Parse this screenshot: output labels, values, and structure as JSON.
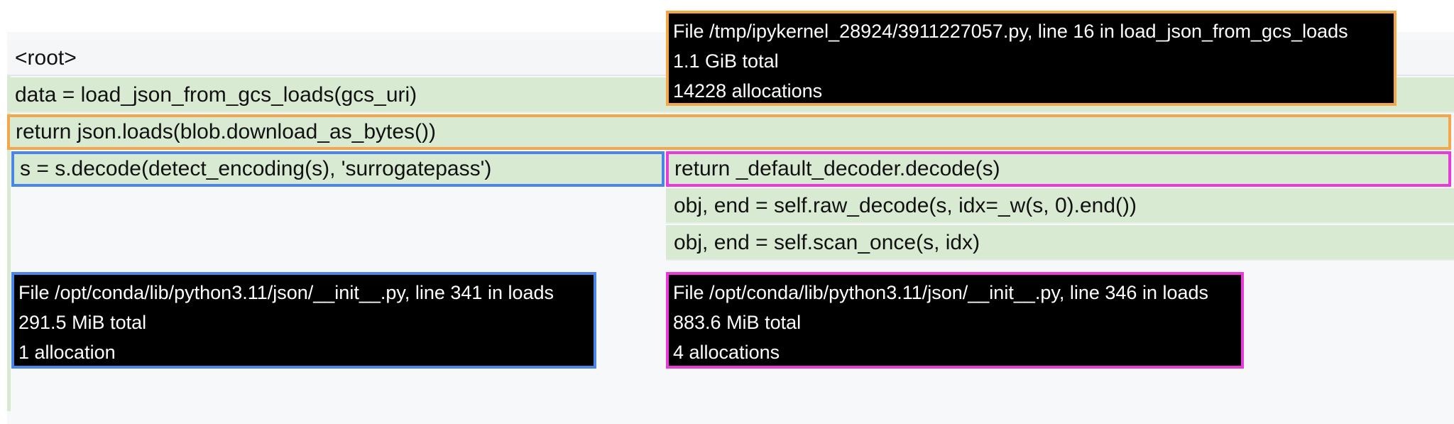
{
  "flamegraph": {
    "frames": [
      {
        "id": "root",
        "label": "<root>"
      },
      {
        "id": "caller",
        "label": "data = load_json_from_gcs_loads(gcs_uri)"
      },
      {
        "id": "json_loads",
        "label": "return json.loads(blob.download_as_bytes())"
      },
      {
        "id": "decode_bytes",
        "label": "s = s.decode(detect_encoding(s), 'surrogatepass')"
      },
      {
        "id": "default_decode",
        "label": "return _default_decoder.decode(s)"
      },
      {
        "id": "raw_decode",
        "label": "obj, end = self.raw_decode(s, idx=_w(s, 0).end())"
      },
      {
        "id": "scan_once",
        "label": "obj, end = self.scan_once(s, idx)"
      }
    ]
  },
  "tooltips": {
    "top": {
      "file": "File /tmp/ipykernel_28924/3911227057.py, line 16 in load_json_from_gcs_loads",
      "total": "1.1 GiB total",
      "allocations": "14228 allocations"
    },
    "left": {
      "file": "File /opt/conda/lib/python3.11/json/__init__.py, line 341 in loads",
      "total": "291.5 MiB total",
      "allocations": "1 allocation"
    },
    "right": {
      "file": "File /opt/conda/lib/python3.11/json/__init__.py, line 346 in loads",
      "total": "883.6 MiB total",
      "allocations": "4 allocations"
    }
  },
  "colors": {
    "frame_green": "#d9ead3",
    "highlight_orange": "#f2a84a",
    "highlight_blue": "#4a86e8",
    "highlight_magenta": "#e83bd9",
    "tooltip_bg": "#000000"
  }
}
